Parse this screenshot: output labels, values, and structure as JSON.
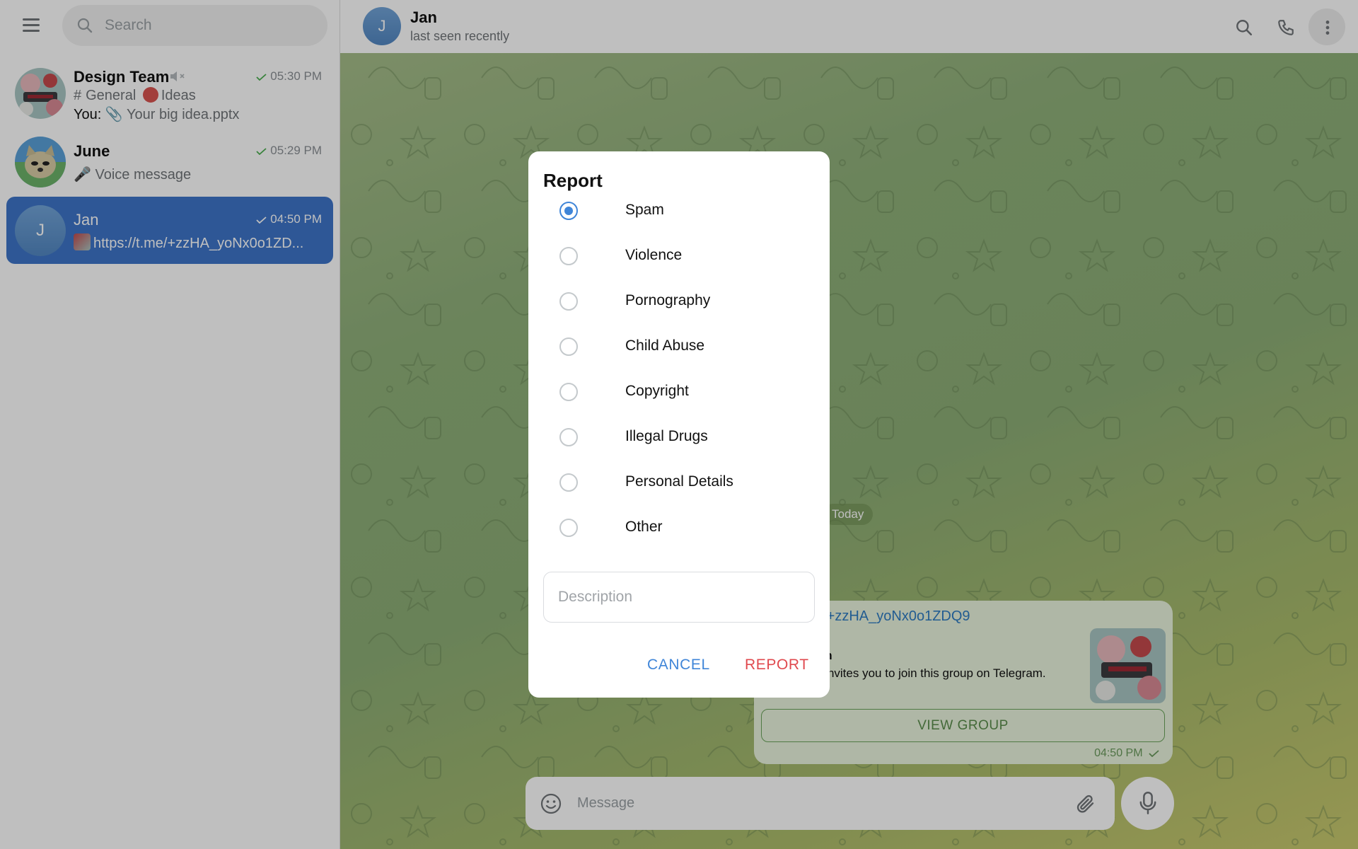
{
  "sidebar": {
    "search_placeholder": "Search",
    "chats": [
      {
        "name": "Design Team",
        "time": "05:30 PM",
        "line1_topic": "General",
        "line1_topic2": "Ideas",
        "line2_prefix": "You:",
        "line2_text": "Your big idea.pptx",
        "muted": true
      },
      {
        "name": "June",
        "time": "05:29 PM",
        "line1": "Voice message"
      },
      {
        "name": "Jan",
        "time": "04:50 PM",
        "initial": "J",
        "line1": "https://t.me/+zzHA_yoNx0o1ZD...",
        "active": true
      }
    ]
  },
  "header": {
    "initial": "J",
    "name": "Jan",
    "status": "last seen recently"
  },
  "chat": {
    "date_label": "Today",
    "message": {
      "link": "e/+zzHA_yoNx0o1ZDQ9",
      "title": "am",
      "description": "n invites you to join this group on Telegram.",
      "button": "VIEW GROUP",
      "time": "04:50 PM"
    },
    "composer_placeholder": "Message"
  },
  "dialog": {
    "title": "Report",
    "options": [
      "Spam",
      "Violence",
      "Pornography",
      "Child Abuse",
      "Copyright",
      "Illegal Drugs",
      "Personal Details",
      "Other"
    ],
    "selected": "Spam",
    "description_placeholder": "Description",
    "cancel": "CANCEL",
    "report": "REPORT"
  },
  "colors": {
    "accent": "#3f85d8",
    "active_chat": "#3e75c9",
    "danger": "#e0494e",
    "bubble": "#eaf4de"
  },
  "icons": [
    "menu-icon",
    "search-icon",
    "phone-icon",
    "more-vertical-icon",
    "emoji-icon",
    "paperclip-icon",
    "microphone-icon",
    "check-icon",
    "muted-icon",
    "hash-icon"
  ]
}
